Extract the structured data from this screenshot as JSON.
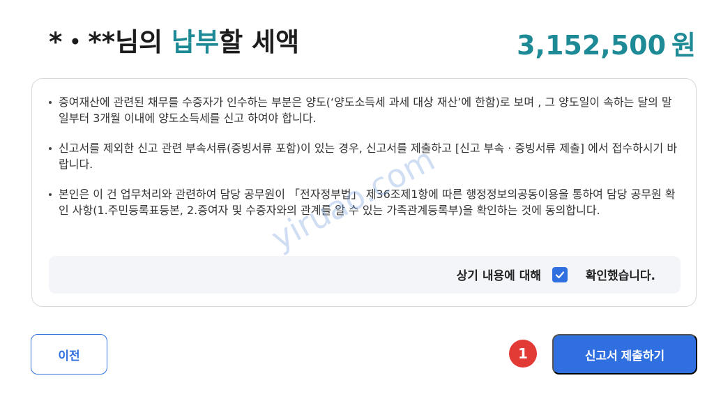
{
  "header": {
    "name_masked": "*・**",
    "title_suffix_1": "님의 ",
    "title_accent": "납부",
    "title_suffix_2": "할 세액",
    "amount": "3,152,500",
    "amount_unit": "원"
  },
  "notices": [
    "증여재산에 관련된 채무를 수증자가 인수하는 부분은 양도(‘양도소득세 과세 대상 재산’에 한함)로 보며 , 그 양도일이 속하는 달의 말일부터 3개월 이내에 양도소득세를 신고 하여야 합니다.",
    "신고서를 제외한 신고 관련 부속서류(증빙서류 포함)이 있는 경우, 신고서를 제출하고 [신고 부속 · 증빙서류 제출] 에서 접수하시기 바랍니다.",
    "본인은 이 건 업무처리와 관련하여 담당 공무원이 「전자정부법」 제36조제1항에 따른 행정정보의공동이용을 통하여 담당 공무원 확인 사항(1.주민등록표등본, 2.증여자 및 수증자와의 관계를 알 수 있는 가족관계등록부)을 확인하는 것에 동의합니다."
  ],
  "confirm": {
    "label": "상기 내용에 대해",
    "checkbox_label": "확인했습니다.",
    "checked": true
  },
  "buttons": {
    "prev_label": "이전",
    "submit_label": "신고서 제출하기"
  },
  "step_badge": "1",
  "watermark": "yiruao.com",
  "colors": {
    "accent_teal": "#1e8a96",
    "primary_blue": "#2f6fe0",
    "badge_red": "#e23b35"
  }
}
